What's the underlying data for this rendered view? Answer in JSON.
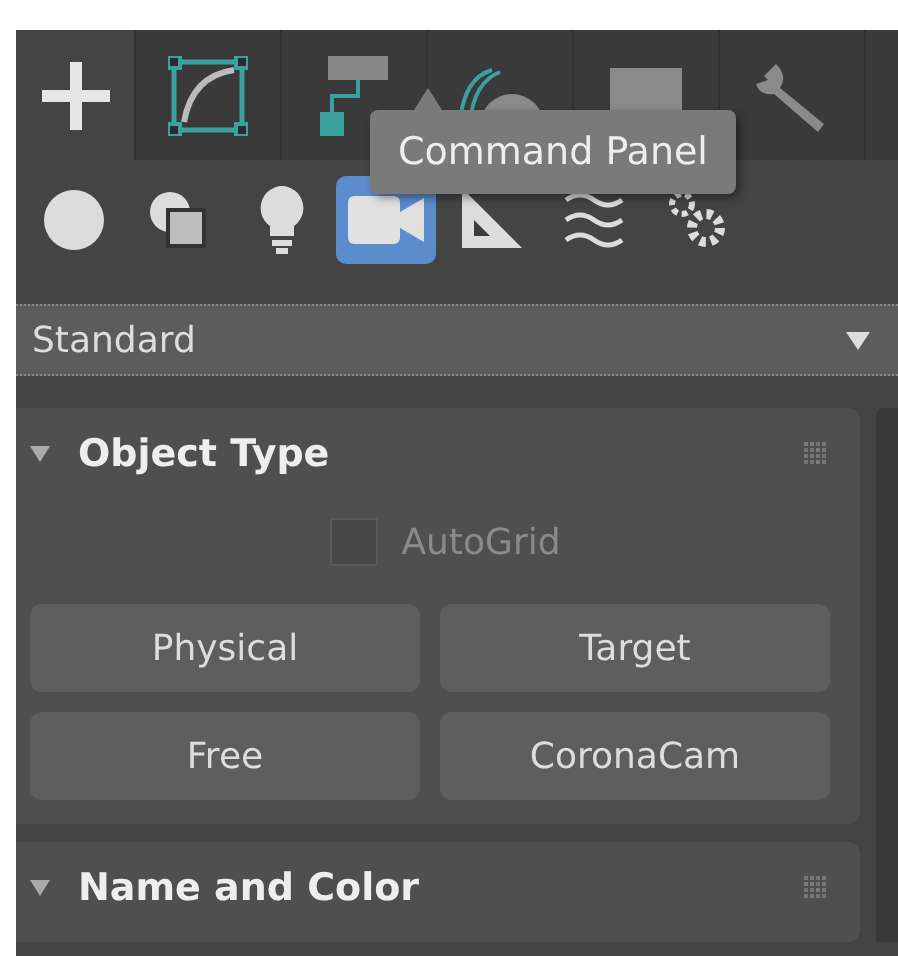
{
  "tabs": [
    {
      "selected": true
    },
    {
      "selected": false
    },
    {
      "selected": false
    },
    {
      "selected": false
    },
    {
      "selected": false
    },
    {
      "selected": false
    }
  ],
  "tooltip": {
    "text": "Command Panel"
  },
  "categories": [
    {
      "selected": false
    },
    {
      "selected": false
    },
    {
      "selected": false
    },
    {
      "selected": true
    },
    {
      "selected": false
    },
    {
      "selected": false
    },
    {
      "selected": false
    }
  ],
  "dropdown": {
    "value": "Standard"
  },
  "rollouts": [
    {
      "title": "Object Type",
      "expanded": true,
      "autogrid": {
        "label": "AutoGrid",
        "checked": false,
        "disabled": true
      },
      "buttons": [
        "Physical",
        "Target",
        "Free",
        "CoronaCam"
      ]
    },
    {
      "title": "Name and Color",
      "expanded": true
    }
  ]
}
